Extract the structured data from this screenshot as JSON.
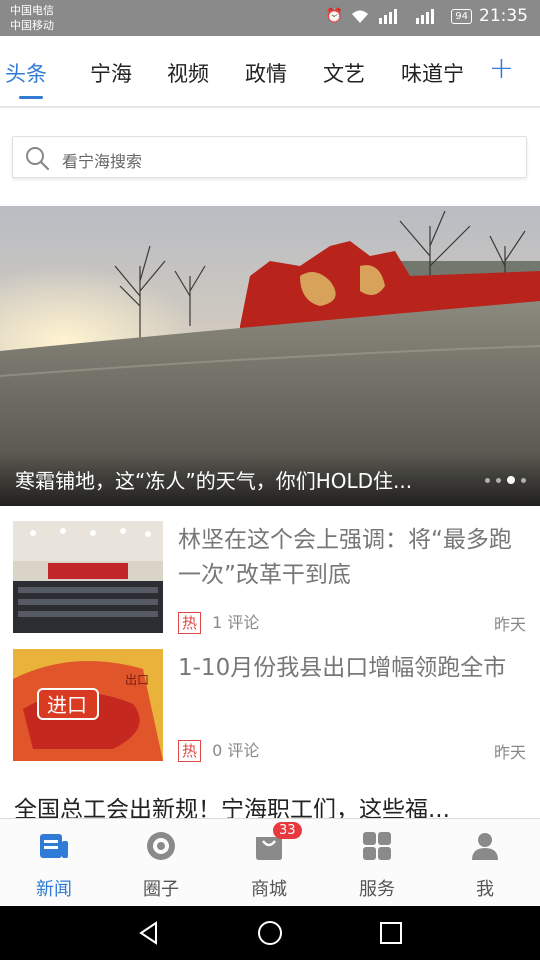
{
  "status": {
    "carrier1": "中国电信",
    "carrier2": "中国移动",
    "battery": "94",
    "time": "21:35"
  },
  "tabs": [
    {
      "label": "头条",
      "active": true
    },
    {
      "label": "宁海"
    },
    {
      "label": "视频"
    },
    {
      "label": "政情"
    },
    {
      "label": "文艺"
    },
    {
      "label": "味道宁"
    }
  ],
  "add_tab_label": "+",
  "search": {
    "placeholder": "看宁海搜索"
  },
  "banner": {
    "title": "寒霜铺地，这“冻人”的天气，你们HOLD住..."
  },
  "news": [
    {
      "title": "林坚在这个会上强调：将“最多跑一次”改革干到底",
      "tag": "热",
      "comments": "1 评论",
      "date": "昨天"
    },
    {
      "title": "1-10月份我县出口增幅领跑全市",
      "tag": "热",
      "comments": "0 评论",
      "date": "昨天"
    }
  ],
  "headline": "全国总工会出新规！宁海职工们，这些福...",
  "bottom_nav": [
    {
      "label": "新闻",
      "icon": "news-icon",
      "active": true
    },
    {
      "label": "圈子",
      "icon": "circle-icon"
    },
    {
      "label": "商城",
      "icon": "shop-bag-icon",
      "badge": "33"
    },
    {
      "label": "服务",
      "icon": "grid-icon"
    },
    {
      "label": "我",
      "icon": "user-icon"
    }
  ],
  "colors": {
    "accent": "#2f7bd6",
    "hot": "#e04848",
    "badge": "#e8393f"
  }
}
